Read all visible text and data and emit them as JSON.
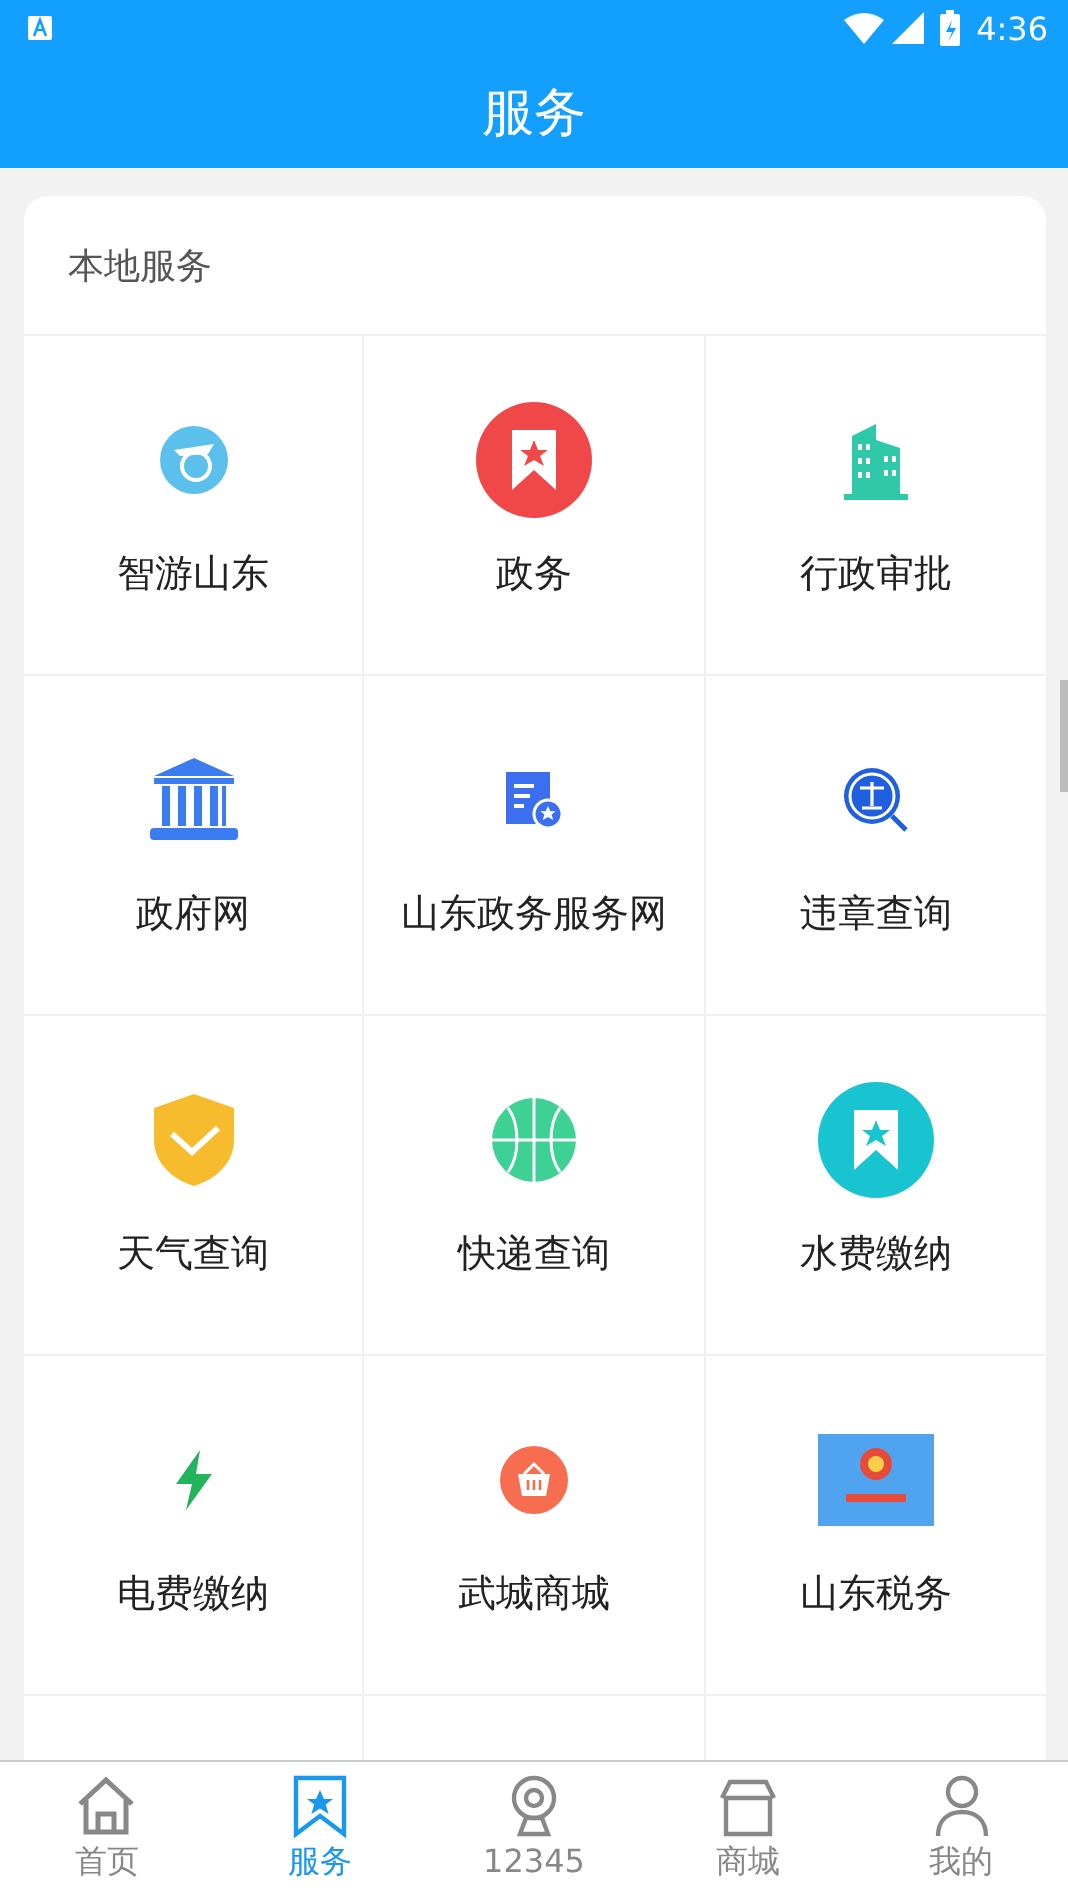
{
  "status_bar": {
    "time": "4:36"
  },
  "title": "服务",
  "section": {
    "title": "本地服务",
    "items": [
      {
        "label": "智游山东"
      },
      {
        "label": "政务"
      },
      {
        "label": "行政审批"
      },
      {
        "label": "政府网"
      },
      {
        "label": "山东政务服务网"
      },
      {
        "label": "违章查询"
      },
      {
        "label": "天气查询"
      },
      {
        "label": "快递查询"
      },
      {
        "label": "水费缴纳"
      },
      {
        "label": "电费缴纳"
      },
      {
        "label": "武城商城"
      },
      {
        "label": "山东税务"
      }
    ]
  },
  "bottom_nav": [
    {
      "label": "首页",
      "selected": false
    },
    {
      "label": "服务",
      "selected": true
    },
    {
      "label": "12345",
      "selected": false
    },
    {
      "label": "商城",
      "selected": false
    },
    {
      "label": "我的",
      "selected": false
    }
  ]
}
